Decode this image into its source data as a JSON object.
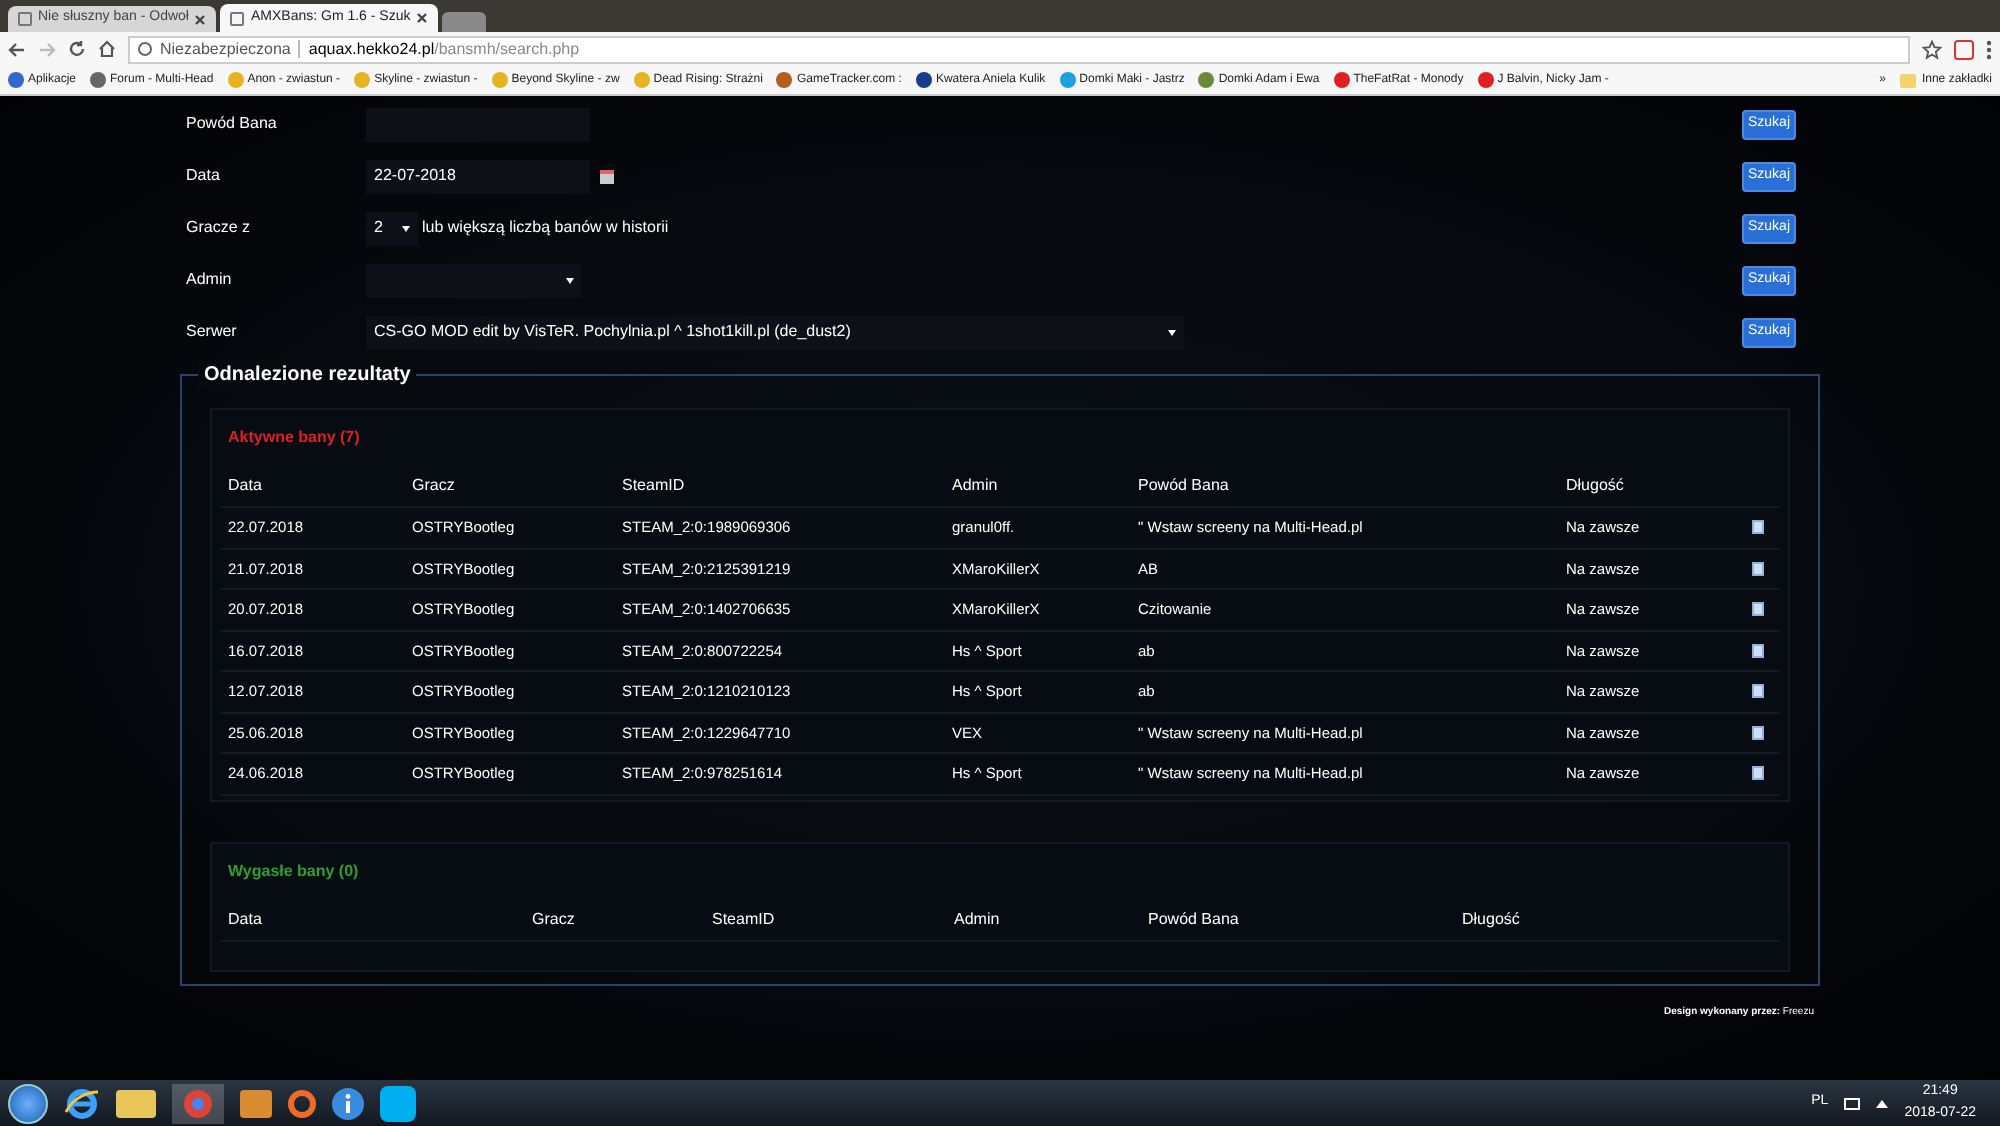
{
  "browser": {
    "tabs": [
      {
        "title": "Nie słuszny ban - Odwoł",
        "selected": false
      },
      {
        "title": "AMXBans: Gm 1.6 - Szuk",
        "selected": true
      }
    ],
    "address": {
      "security": "Niezabezpieczona",
      "host": "aquax.hekko24.pl",
      "path": "/bansmh/search.php"
    },
    "bookmarks": [
      "Aplikacje",
      "Forum - Multi-Head",
      "Anon - zwiastun - ",
      "Skyline - zwiastun - ",
      "Beyond Skyline - zw",
      "Dead Rising: Strażni",
      "GameTracker.com : ",
      "Kwatera Aniela Kulik",
      "Domki Maki - Jastrz",
      "Domki Adam i Ewa ",
      "TheFatRat - Monody",
      "J Balvin, Nicky Jam -"
    ],
    "more": "»",
    "other_bookmarks": "Inne zakładki"
  },
  "form": {
    "rows": [
      {
        "kind": "text",
        "label": "Powód Bana",
        "value": "",
        "button": "Szukaj"
      },
      {
        "kind": "date",
        "label": "Data",
        "value": "22-07-2018",
        "button": "Szukaj"
      },
      {
        "kind": "count",
        "label": "Gracze z",
        "value": "2",
        "suffix": "lub większą liczbą banów w historii",
        "button": "Szukaj"
      },
      {
        "kind": "select",
        "label": "Admin",
        "value": "",
        "button": "Szukaj"
      },
      {
        "kind": "server",
        "label": "Serwer",
        "value": "CS-GO MOD edit by VisTeR. Pochylnia.pl ^ 1shot1kill.pl (de_dust2)",
        "button": "Szukaj"
      }
    ]
  },
  "results": {
    "title": "Odnalezione rezultaty",
    "active": {
      "title": "Aktywne bany (7)",
      "columns": [
        "Data",
        "Gracz",
        "SteamID",
        "Admin",
        "Powód Bana",
        "Długość"
      ],
      "rows": [
        [
          "22.07.2018",
          "OSTRYBootleg",
          "STEAM_2:0:1989069306",
          "granul0ff.",
          "\" Wstaw screeny na Multi-Head.pl",
          "Na zawsze"
        ],
        [
          "21.07.2018",
          "OSTRYBootleg",
          "STEAM_2:0:2125391219",
          "XMaroKillerX",
          "AB",
          "Na zawsze"
        ],
        [
          "20.07.2018",
          "OSTRYBootleg",
          "STEAM_2:0:1402706635",
          "XMaroKillerX",
          "Czitowanie",
          "Na zawsze"
        ],
        [
          "16.07.2018",
          "OSTRYBootleg",
          "STEAM_2:0:800722254",
          "Hs ^ Sport",
          "ab",
          "Na zawsze"
        ],
        [
          "12.07.2018",
          "OSTRYBootleg",
          "STEAM_2:0:1210210123",
          "Hs ^ Sport",
          "ab",
          "Na zawsze"
        ],
        [
          "25.06.2018",
          "OSTRYBootleg",
          "STEAM_2:0:1229647710",
          "VEX",
          "\" Wstaw screeny na Multi-Head.pl",
          "Na zawsze"
        ],
        [
          "24.06.2018",
          "OSTRYBootleg",
          "STEAM_2:0:978251614",
          "Hs ^ Sport",
          "\" Wstaw screeny na Multi-Head.pl",
          "Na zawsze"
        ]
      ]
    },
    "expired": {
      "title": "Wygasłe bany (0)",
      "columns": [
        "Data",
        "Gracz",
        "SteamID",
        "Admin",
        "Powód Bana",
        "Długość"
      ]
    }
  },
  "footer": "**Design wykonany przez:** Freezu",
  "taskbar": {
    "language": "PL",
    "time": "21:49",
    "date": "2018-07-22"
  }
}
